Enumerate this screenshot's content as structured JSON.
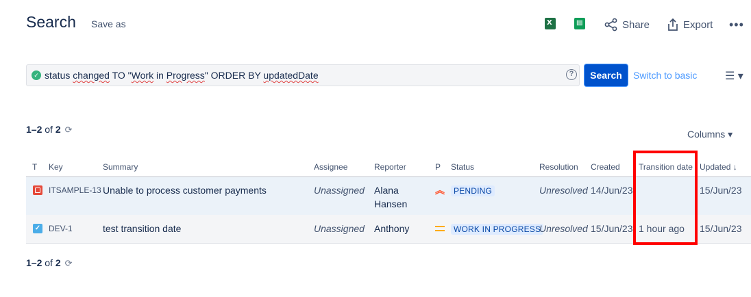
{
  "header": {
    "title": "Search",
    "save_as": "Save as",
    "share": "Share",
    "export": "Export",
    "more": "•••",
    "excel_icon": "excel-icon",
    "sheets_icon": "google-sheets-icon"
  },
  "search": {
    "query_parts": [
      "status ",
      "changed",
      " TO \"",
      "Work",
      " in ",
      "Progress",
      "\" ORDER BY ",
      "updatedDate"
    ],
    "help": "?",
    "button": "Search",
    "switch_basic": "Switch to basic"
  },
  "results": {
    "count_prefix": "1–2",
    "count_of": " of ",
    "count_total": "2",
    "columns": "Columns"
  },
  "table": {
    "headers": {
      "type": "T",
      "key": "Key",
      "summary": "Summary",
      "assignee": "Assignee",
      "reporter": "Reporter",
      "priority": "P",
      "status": "Status",
      "resolution": "Resolution",
      "created": "Created",
      "transition_date": "Transition date",
      "updated": "Updated"
    },
    "rows": [
      {
        "key": "ITSAMPLE-13",
        "summary": "Unable to process customer payments",
        "assignee": "Unassigned",
        "reporter_line1": "Alana",
        "reporter_line2": "Hansen",
        "status": "PENDING",
        "resolution": "Unresolved",
        "created": "14/Jun/23",
        "transition_date": "",
        "updated": "15/Jun/23"
      },
      {
        "key": "DEV-1",
        "summary": "test transition date",
        "assignee": "Unassigned",
        "reporter": "Anthony",
        "status": "WORK IN PROGRESS",
        "resolution": "Unresolved",
        "created": "15/Jun/23",
        "transition_date": "1 hour ago",
        "updated": "15/Jun/23"
      }
    ]
  },
  "colors": {
    "primary": "#0052cc",
    "highlight": "#ff0000",
    "status_bg": "#deebff"
  }
}
